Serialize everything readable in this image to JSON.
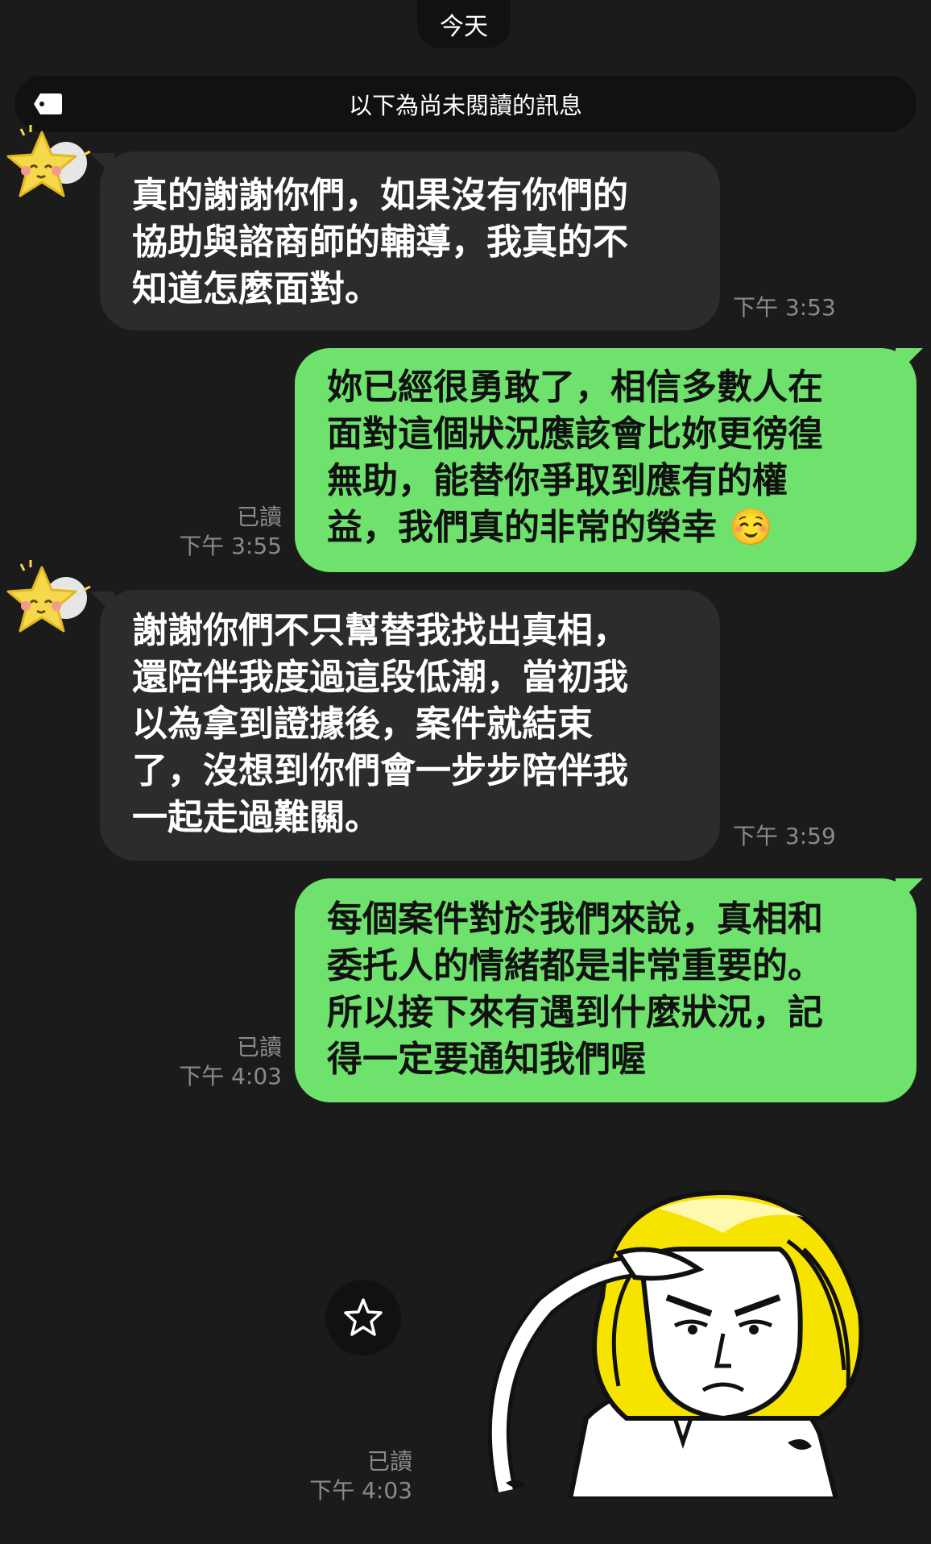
{
  "header": {
    "date_label": "今天"
  },
  "unread": {
    "label": "以下為尚未閱讀的訊息",
    "icon": "tag-icon"
  },
  "messages": [
    {
      "direction": "incoming",
      "text": "真的謝謝你們，如果沒有你們的\n協助與諮商師的輔導，我真的不\n知道怎麼面對。",
      "time": "下午 3:53",
      "avatar": "star-avatar-icon"
    },
    {
      "direction": "outgoing",
      "text": "妳已經很勇敢了，相信多數人在\n面對這個狀況應該會比妳更徬徨\n無助，能替你爭取到應有的權\n益，我們真的非常的榮幸",
      "emoji": "☺️",
      "read": "已讀",
      "time": "下午 3:55"
    },
    {
      "direction": "incoming",
      "text": "謝謝你們不只幫替我找出真相，\n還陪伴我度過這段低潮，當初我\n以為拿到證據後，案件就結束\n了，沒想到你們會一步步陪伴我\n一起走過難關。",
      "time": "下午 3:59",
      "avatar": "star-avatar-icon"
    },
    {
      "direction": "outgoing",
      "text": "每個案件對於我們來說，真相和\n委托人的情緒都是非常重要的。\n所以接下來有遇到什麼狀況，記\n得一定要通知我們喔",
      "read": "已讀",
      "time": "下午 4:03"
    },
    {
      "direction": "outgoing",
      "type": "sticker",
      "sticker": "saluting-girl-sticker",
      "read": "已讀",
      "time": "下午 4:03"
    }
  ],
  "colors": {
    "background": "#1b1b1b",
    "incoming_bubble": "#2c2c2c",
    "outgoing_bubble": "#6ee26c",
    "meta_text": "#8a8a8a"
  }
}
